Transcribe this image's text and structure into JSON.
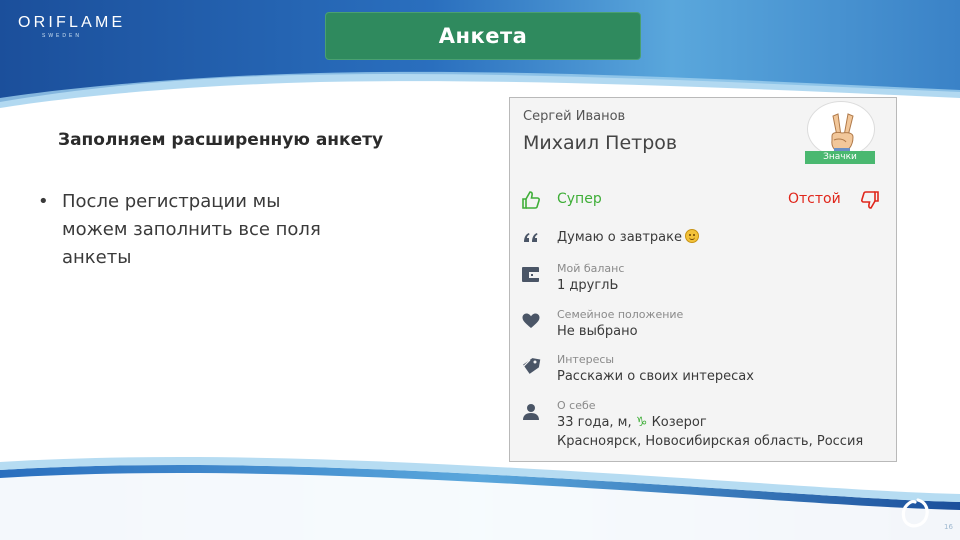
{
  "brand": {
    "name": "ORIFLAME",
    "sub": "SWEDEN"
  },
  "slide": {
    "title": "Анкета",
    "subtitle": "Заполняем расширенную анкету",
    "bullet": "После регистрации мы можем заполнить все поля анкеты",
    "page_number": "16"
  },
  "profile": {
    "name_small": "Сергей Иванов",
    "name_big": "Михаил Петров",
    "badge": "Значки",
    "like_label": "Супер",
    "dislike_label": "Отстой",
    "status": "Думаю о завтраке",
    "balance_label": "Мой баланс",
    "balance_value": "1 друглЬ",
    "family_label": "Семейное положение",
    "family_value": "Не выбрано",
    "interests_label": "Интересы",
    "interests_value": "Расскажи о своих интересах",
    "about_label": "О себе",
    "about_value_prefix": "33 года, м,",
    "about_zodiac_symbol": "♑",
    "about_zodiac": "Козерог",
    "about_location": "Красноярск, Новосибирская область, Россия"
  },
  "colors": {
    "title_bg": "#2f8a5e",
    "like": "#3fae38",
    "dislike": "#e0261b",
    "badge_bg": "#4ab870",
    "frame_blue": "#1f5fae"
  },
  "icons": [
    "thumbs-up-icon",
    "thumbs-down-icon",
    "quote-icon",
    "wallet-icon",
    "heart-icon",
    "tag-icon",
    "person-icon",
    "victory-hand-icon",
    "smile-emoji-icon",
    "oriflame-circle-icon"
  ]
}
